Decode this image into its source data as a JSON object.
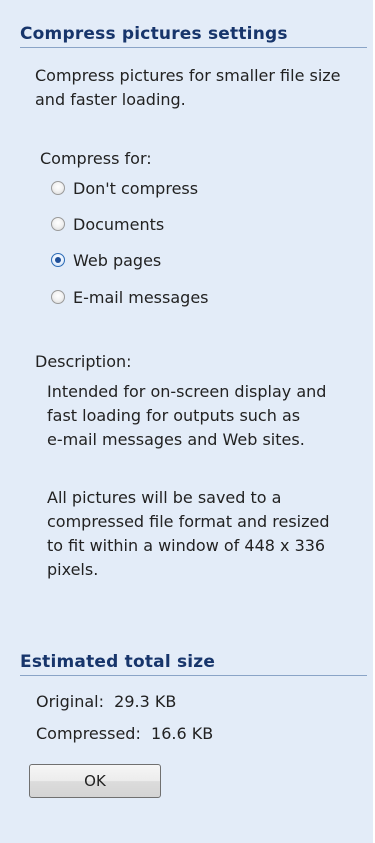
{
  "compress_settings": {
    "header": "Compress pictures settings",
    "intro_line1": "Compress pictures for smaller file size",
    "intro_line2": "and faster loading.",
    "compress_for_label": "Compress for:",
    "options": [
      {
        "label": "Don't compress",
        "checked": false
      },
      {
        "label": "Documents",
        "checked": false
      },
      {
        "label": "Web pages",
        "checked": true
      },
      {
        "label": "E-mail messages",
        "checked": false
      }
    ],
    "description_label": "Description:",
    "description_lines": [
      "Intended for on-screen display and",
      "fast loading for outputs such as",
      "e-mail messages and Web sites."
    ],
    "detail_lines": [
      "All pictures will be saved to a",
      "compressed file format and resized",
      "to fit within a window of 448 x 336",
      "pixels."
    ]
  },
  "estimated_size": {
    "header": "Estimated total size",
    "original_label": "Original:",
    "original_value": "29.3 KB",
    "compressed_label": "Compressed:",
    "compressed_value": "16.6 KB"
  },
  "ok_button_label": "OK",
  "colors": {
    "pane_background": "#e3ecf8",
    "header_text": "#17356b",
    "selected_radio": "#1e4f99"
  }
}
